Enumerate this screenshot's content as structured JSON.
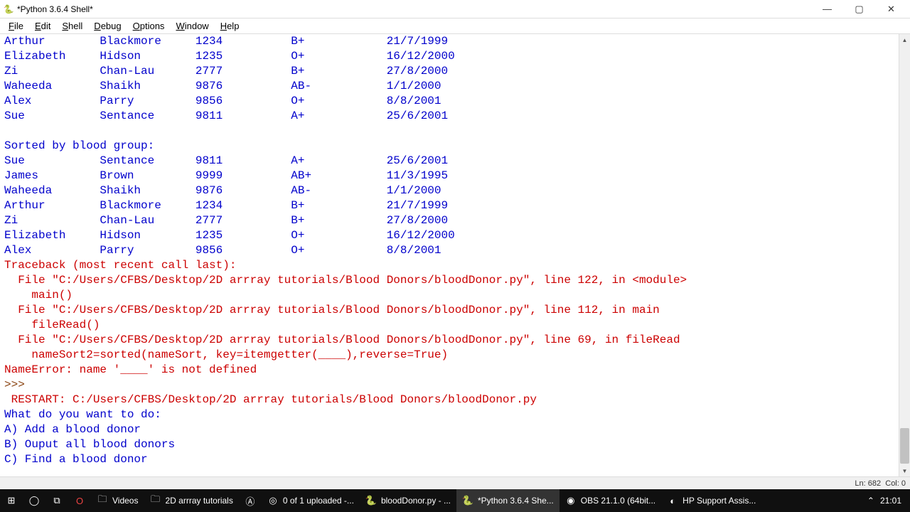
{
  "window": {
    "title": "*Python 3.6.4 Shell*",
    "icon": "🐍"
  },
  "menu": {
    "file": "File",
    "edit": "Edit",
    "shell": "Shell",
    "debug": "Debug",
    "options": "Options",
    "window": "Window",
    "help": "Help"
  },
  "colors": {
    "stdout": "#0000cc",
    "stderr": "#cc0000",
    "prompt": "#8b4513"
  },
  "output": {
    "rows1": [
      {
        "fn": "Arthur",
        "ln": "Blackmore",
        "id": "1234",
        "bg": "B+",
        "dob": "21/7/1999"
      },
      {
        "fn": "Elizabeth",
        "ln": "Hidson",
        "id": "1235",
        "bg": "O+",
        "dob": "16/12/2000"
      },
      {
        "fn": "Zi",
        "ln": "Chan-Lau",
        "id": "2777",
        "bg": "B+",
        "dob": "27/8/2000"
      },
      {
        "fn": "Waheeda",
        "ln": "Shaikh",
        "id": "9876",
        "bg": "AB-",
        "dob": "1/1/2000"
      },
      {
        "fn": "Alex",
        "ln": "Parry",
        "id": "9856",
        "bg": "O+",
        "dob": "8/8/2001"
      },
      {
        "fn": "Sue",
        "ln": "Sentance",
        "id": "9811",
        "bg": "A+",
        "dob": "25/6/2001"
      }
    ],
    "sorted_header": "Sorted by blood group:",
    "rows2": [
      {
        "fn": "Sue",
        "ln": "Sentance",
        "id": "9811",
        "bg": "A+",
        "dob": "25/6/2001"
      },
      {
        "fn": "James",
        "ln": "Brown",
        "id": "9999",
        "bg": "AB+",
        "dob": "11/3/1995"
      },
      {
        "fn": "Waheeda",
        "ln": "Shaikh",
        "id": "9876",
        "bg": "AB-",
        "dob": "1/1/2000"
      },
      {
        "fn": "Arthur",
        "ln": "Blackmore",
        "id": "1234",
        "bg": "B+",
        "dob": "21/7/1999"
      },
      {
        "fn": "Zi",
        "ln": "Chan-Lau",
        "id": "2777",
        "bg": "B+",
        "dob": "27/8/2000"
      },
      {
        "fn": "Elizabeth",
        "ln": "Hidson",
        "id": "1235",
        "bg": "O+",
        "dob": "16/12/2000"
      },
      {
        "fn": "Alex",
        "ln": "Parry",
        "id": "9856",
        "bg": "O+",
        "dob": "8/8/2001"
      }
    ],
    "traceback_header": "Traceback (most recent call last):",
    "tb": [
      "  File \"C:/Users/CFBS/Desktop/2D arrray tutorials/Blood Donors/bloodDonor.py\", line 122, in <module>",
      "    main()",
      "  File \"C:/Users/CFBS/Desktop/2D arrray tutorials/Blood Donors/bloodDonor.py\", line 112, in main",
      "    fileRead()",
      "  File \"C:/Users/CFBS/Desktop/2D arrray tutorials/Blood Donors/bloodDonor.py\", line 69, in fileRead",
      "    nameSort2=sorted(nameSort, key=itemgetter(____),reverse=True)"
    ],
    "name_error": "NameError: name '____' is not defined",
    "prompt": ">>> ",
    "restart": " RESTART: C:/Users/CFBS/Desktop/2D arrray tutorials/Blood Donors/bloodDonor.py ",
    "menu_q": "What do you want to do:",
    "menu_a": "A) Add a blood donor",
    "menu_b": "B) Ouput all blood donors",
    "menu_c": "C) Find a blood donor"
  },
  "status": {
    "ln": "Ln: 682",
    "col": "Col: 0"
  },
  "taskbar": {
    "items": [
      {
        "label": "Videos",
        "icon": "🗀"
      },
      {
        "label": "2D arrray tutorials",
        "icon": "🗀"
      },
      {
        "label": "",
        "icon": "Ⓐ"
      },
      {
        "label": "0 of 1 uploaded -...",
        "icon": "◎"
      },
      {
        "label": "bloodDonor.py - ...",
        "icon": "🐍"
      },
      {
        "label": "*Python 3.6.4 She...",
        "icon": "🐍",
        "active": true
      },
      {
        "label": "OBS 21.1.0 (64bit...",
        "icon": "◉"
      },
      {
        "label": "HP Support Assis...",
        "icon": "◐"
      }
    ],
    "tray": {
      "net": "⋀",
      "time": "21:01",
      "showdesktop": ""
    }
  }
}
